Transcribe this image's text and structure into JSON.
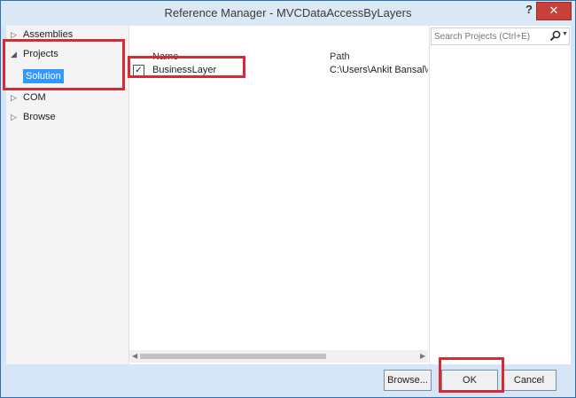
{
  "window": {
    "title": "Reference Manager - MVCDataAccessByLayers",
    "help_label": "?",
    "close_label": "✕"
  },
  "nav": {
    "items": [
      {
        "label": "Assemblies",
        "arrow": "▷"
      },
      {
        "label": "Projects",
        "arrow": "◢"
      },
      {
        "label": "COM",
        "arrow": "▷"
      },
      {
        "label": "Browse",
        "arrow": "▷"
      }
    ],
    "sub_item": "Solution"
  },
  "list": {
    "columns": [
      "Name",
      "Path"
    ],
    "rows": [
      {
        "name": "BusinessLayer",
        "path": "C:\\Users\\Ankit Bansal\\doc",
        "checked": true
      }
    ]
  },
  "search": {
    "placeholder": "Search Projects (Ctrl+E)"
  },
  "footer": {
    "browse_label": "Browse...",
    "ok_label": "OK",
    "cancel_label": "Cancel"
  },
  "colors": {
    "accent": "#3399ff",
    "highlight": "#d42b35",
    "frame": "#d6e6f6",
    "close": "#c7403a"
  }
}
